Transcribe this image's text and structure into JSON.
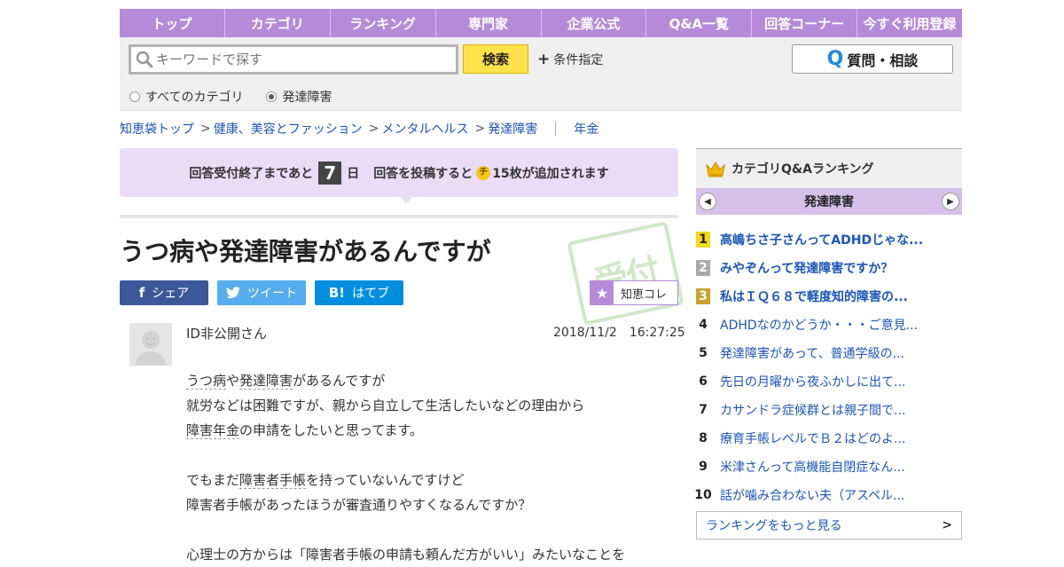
{
  "nav": [
    "トップ",
    "カテゴリ",
    "ランキング",
    "専門家",
    "企業公式",
    "Q&A一覧",
    "回答コーナー",
    "今すぐ利用登録"
  ],
  "search": {
    "placeholder": "キーワードで探す",
    "button": "検索",
    "conditions": "条件指定",
    "ask_button": "質問・相談",
    "radios": [
      {
        "label": "すべてのカテゴリ",
        "selected": false
      },
      {
        "label": "発達障害",
        "selected": true
      }
    ]
  },
  "breadcrumb": [
    "知恵袋トップ",
    "健康、美容とファッション",
    "メンタルヘルス",
    "発達障害"
  ],
  "breadcrumb_extra": "年金",
  "banner": {
    "before": "回答受付終了まであと",
    "days": "7",
    "days_unit": "日",
    "middle": "回答を投稿すると",
    "coin": "チ",
    "after": "15枚が追加されます"
  },
  "question": {
    "title": "うつ病や発達障害があるんですが",
    "stamp": "受付",
    "share": {
      "facebook": "シェア",
      "twitter": "ツイート",
      "hatena": "はてブ",
      "hatena_icon": "B!"
    },
    "collect": "知恵コレ",
    "user": "ID非公開さん",
    "date": "2018/11/2　16:27:25",
    "lines": [
      [
        {
          "t": "うつ病",
          "k": true
        },
        {
          "t": "や",
          "k": false
        },
        {
          "t": "発達障害",
          "k": true
        },
        {
          "t": "があるんですが",
          "k": false
        }
      ],
      [
        {
          "t": "就労などは困難ですが、親から自立して生活したいなどの理由から",
          "k": false
        }
      ],
      [
        {
          "t": "障害年金",
          "k": true
        },
        {
          "t": "の申請をしたいと思ってます。",
          "k": false
        }
      ],
      [],
      [
        {
          "t": "でもまだ",
          "k": false
        },
        {
          "t": "障害者手帳",
          "k": true
        },
        {
          "t": "を持っていないんですけど",
          "k": false
        }
      ],
      [
        {
          "t": "障害者手帳があったほうが審査通りやすくなるんですか？",
          "k": false
        }
      ],
      [],
      [
        {
          "t": "心理士の方からは「障害者手帳の申請も頼んだ方がいい」みたいなことを",
          "k": false
        }
      ]
    ]
  },
  "sidebar": {
    "heading": "カテゴリQ&Aランキング",
    "category": "発達障害",
    "items": [
      {
        "n": "1",
        "text": "高嶋ちさ子さんってADHDじゃな..."
      },
      {
        "n": "2",
        "text": "みやぞんって発達障害ですか？"
      },
      {
        "n": "3",
        "text": "私はＩＱ６８で軽度知的障害の..."
      },
      {
        "n": "4",
        "text": "ADHDなのかどうか・・・ご意見..."
      },
      {
        "n": "5",
        "text": "発達障害があって、普通学級の..."
      },
      {
        "n": "6",
        "text": "先日の月曜から夜ふかしに出て..."
      },
      {
        "n": "7",
        "text": "カサンドラ症候群とは親子間で..."
      },
      {
        "n": "8",
        "text": "療育手帳レベルでＢ２はどのよ..."
      },
      {
        "n": "9",
        "text": "米津さんって高機能自閉症なん..."
      },
      {
        "n": "10",
        "text": "話が噛み合わない夫（アスペル..."
      }
    ],
    "more": "ランキングをもっと見る"
  }
}
